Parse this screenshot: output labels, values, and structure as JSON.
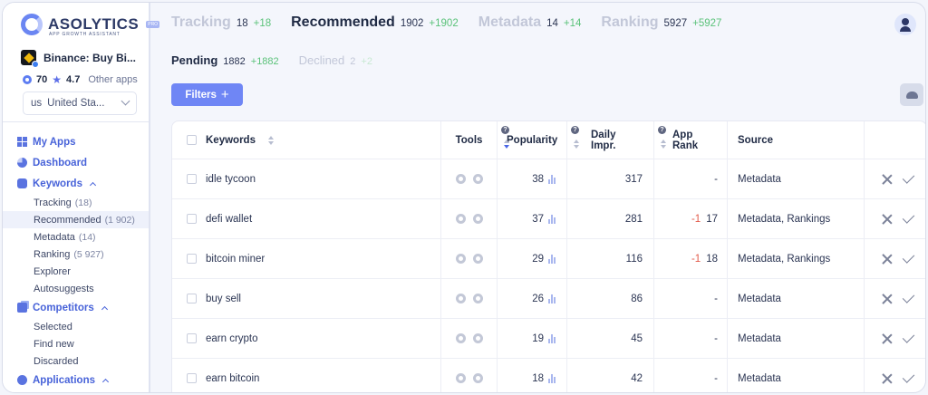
{
  "brand": {
    "name": "ASOLYTICS",
    "tagline": "APP GROWTH ASSISTANT",
    "badge": "PRO"
  },
  "app": {
    "name": "Binance: Buy Bi...",
    "score": "70",
    "rating": "4.7",
    "other_apps": "Other apps"
  },
  "country": {
    "code": "us",
    "name": "United Sta..."
  },
  "nav": {
    "my_apps": "My Apps",
    "dashboard": "Dashboard",
    "keywords": "Keywords",
    "keyword_items": [
      {
        "label": "Tracking",
        "count": "(18)"
      },
      {
        "label": "Recommended",
        "count": "(1 902)"
      },
      {
        "label": "Metadata",
        "count": "(14)"
      },
      {
        "label": "Ranking",
        "count": "(5 927)"
      },
      {
        "label": "Explorer",
        "count": ""
      },
      {
        "label": "Autosuggests",
        "count": ""
      }
    ],
    "competitors": "Competitors",
    "competitor_items": [
      {
        "label": "Selected"
      },
      {
        "label": "Find new"
      },
      {
        "label": "Discarded"
      }
    ],
    "applications": "Applications"
  },
  "tabs": [
    {
      "label": "Tracking",
      "count": "18",
      "delta": "+18"
    },
    {
      "label": "Recommended",
      "count": "1902",
      "delta": "+1902"
    },
    {
      "label": "Metadata",
      "count": "14",
      "delta": "+14"
    },
    {
      "label": "Ranking",
      "count": "5927",
      "delta": "+5927"
    }
  ],
  "subtabs": [
    {
      "label": "Pending",
      "count": "1882",
      "delta": "+1882"
    },
    {
      "label": "Declined",
      "count": "2",
      "delta": "+2"
    }
  ],
  "filters_label": "Filters",
  "table": {
    "headers": {
      "keywords": "Keywords",
      "tools": "Tools",
      "popularity": "Popularity",
      "daily": "Daily Impr.",
      "rank": "App Rank",
      "source": "Source"
    },
    "rows": [
      {
        "keyword": "idle tycoon",
        "popularity": "38",
        "daily": "317",
        "rank_delta": "",
        "rank": "-",
        "source": "Metadata"
      },
      {
        "keyword": "defi wallet",
        "popularity": "37",
        "daily": "281",
        "rank_delta": "-1",
        "rank": "17",
        "source": "Metadata, Rankings"
      },
      {
        "keyword": "bitcoin miner",
        "popularity": "29",
        "daily": "116",
        "rank_delta": "-1",
        "rank": "18",
        "source": "Metadata, Rankings"
      },
      {
        "keyword": "buy sell",
        "popularity": "26",
        "daily": "86",
        "rank_delta": "",
        "rank": "-",
        "source": "Metadata"
      },
      {
        "keyword": "earn crypto",
        "popularity": "19",
        "daily": "45",
        "rank_delta": "",
        "rank": "-",
        "source": "Metadata"
      },
      {
        "keyword": "earn bitcoin",
        "popularity": "18",
        "daily": "42",
        "rank_delta": "",
        "rank": "-",
        "source": "Metadata"
      }
    ]
  }
}
